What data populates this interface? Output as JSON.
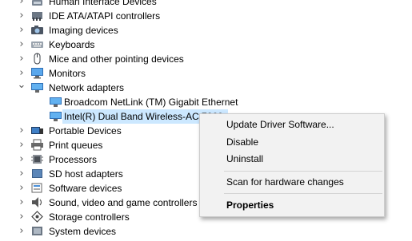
{
  "tree": [
    {
      "label": "Human Interface Devices",
      "icon": "hid-icon",
      "expanded": false
    },
    {
      "label": "IDE ATA/ATAPI controllers",
      "icon": "ide-controller-icon",
      "expanded": false
    },
    {
      "label": "Imaging devices",
      "icon": "camera-icon",
      "expanded": false
    },
    {
      "label": "Keyboards",
      "icon": "keyboard-icon",
      "expanded": false
    },
    {
      "label": "Mice and other pointing devices",
      "icon": "mouse-icon",
      "expanded": false
    },
    {
      "label": "Monitors",
      "icon": "monitor-icon",
      "expanded": false
    },
    {
      "label": "Network adapters",
      "icon": "network-adapter-icon",
      "expanded": true
    },
    {
      "label": "Broadcom NetLink (TM) Gigabit Ethernet",
      "icon": "network-adapter-icon",
      "child": true
    },
    {
      "label": "Intel(R) Dual Band Wireless-AC 7260",
      "icon": "network-adapter-icon",
      "child": true,
      "selected": true
    },
    {
      "label": "Portable Devices",
      "icon": "portable-device-icon",
      "expanded": false
    },
    {
      "label": "Print queues",
      "icon": "printer-icon",
      "expanded": false
    },
    {
      "label": "Processors",
      "icon": "processor-icon",
      "expanded": false
    },
    {
      "label": "SD host adapters",
      "icon": "sd-card-icon",
      "expanded": false
    },
    {
      "label": "Software devices",
      "icon": "software-device-icon",
      "expanded": false
    },
    {
      "label": "Sound, video and game controllers",
      "icon": "speaker-icon",
      "expanded": false
    },
    {
      "label": "Storage controllers",
      "icon": "storage-controller-icon",
      "expanded": false
    },
    {
      "label": "System devices",
      "icon": "system-device-icon",
      "expanded": false
    }
  ],
  "chevrons": {
    "collapsed": "›",
    "expanded": "⌄"
  },
  "context_menu": {
    "update_driver": "Update Driver Software...",
    "disable": "Disable",
    "uninstall": "Uninstall",
    "scan": "Scan for hardware changes",
    "properties": "Properties"
  },
  "colors": {
    "selection": "#cce8ff",
    "menu_background": "#f2f2f2"
  }
}
